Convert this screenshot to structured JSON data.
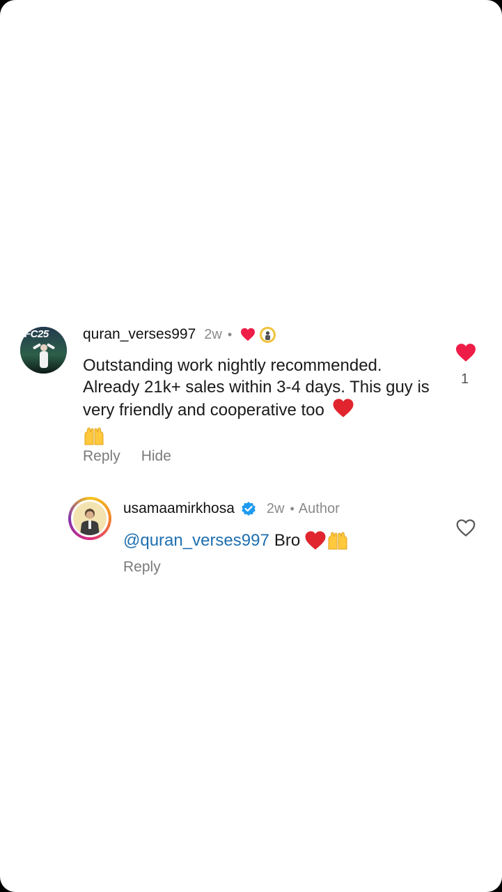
{
  "comments": [
    {
      "username": "quran_verses997",
      "time": "2w",
      "text": "Outstanding work nightly recommended. Already 21k+ sales within 3-4 days. This guy is very friendly and cooperative too",
      "actions": {
        "reply": "Reply",
        "hide": "Hide"
      },
      "like_count": "1",
      "liked": true,
      "avatar_text": "FC25"
    },
    {
      "username": "usamaamirkhosa",
      "verified": true,
      "time": "2w",
      "author_badge": "Author",
      "mention": "@quran_verses997",
      "text": "Bro",
      "actions": {
        "reply": "Reply"
      },
      "liked": false
    }
  ],
  "colors": {
    "like_red": "#ee1d47",
    "verified_blue": "#1d9bf0",
    "mention_blue": "#1f6fb0"
  }
}
